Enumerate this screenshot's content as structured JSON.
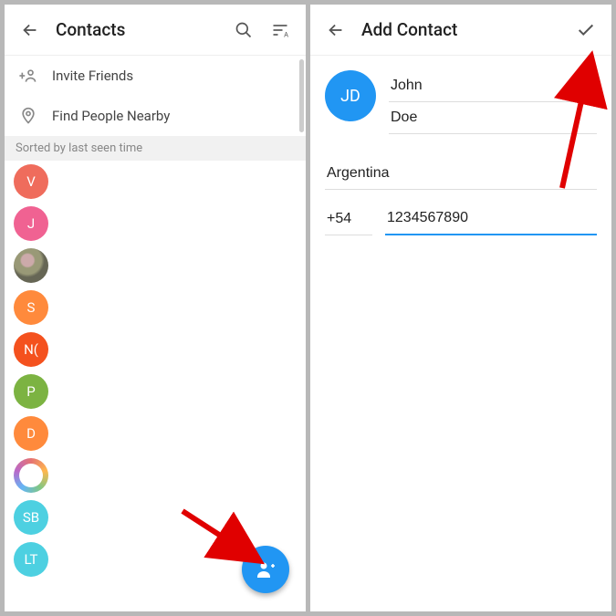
{
  "left": {
    "title": "Contacts",
    "inviteFriends": "Invite Friends",
    "findNearby": "Find People Nearby",
    "sortHeader": "Sorted by last seen time",
    "contacts": [
      {
        "initials": "V",
        "color": "#ef6c5c",
        "type": "letter"
      },
      {
        "initials": "J",
        "color": "#f06292",
        "type": "letter"
      },
      {
        "initials": "",
        "color": "",
        "type": "photo"
      },
      {
        "initials": "S",
        "color": "#ff8a3c",
        "type": "letter"
      },
      {
        "initials": "N(",
        "color": "#f4511e",
        "type": "letter"
      },
      {
        "initials": "P",
        "color": "#7cb342",
        "type": "letter"
      },
      {
        "initials": "D",
        "color": "#ff8a3c",
        "type": "letter"
      },
      {
        "initials": "",
        "color": "",
        "type": "group"
      },
      {
        "initials": "SB",
        "color": "#4dd0e1",
        "type": "letter"
      },
      {
        "initials": "LT",
        "color": "#4dd0e1",
        "type": "letter"
      }
    ]
  },
  "right": {
    "title": "Add Contact",
    "avatarInitials": "JD",
    "firstName": "John",
    "lastName": "Doe",
    "country": "Argentina",
    "dialCode": "+54",
    "phone": "1234567890"
  }
}
